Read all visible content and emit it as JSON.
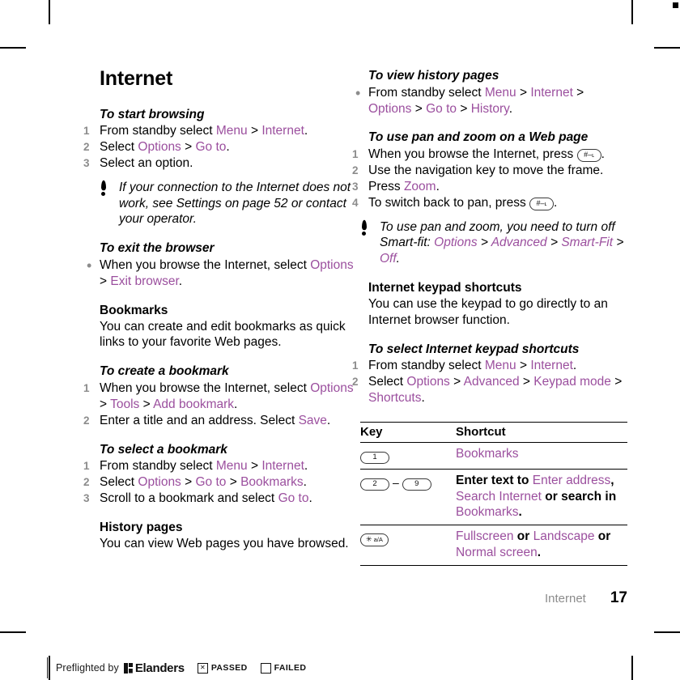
{
  "document": {
    "chapter_title": "Internet",
    "footer_chapter": "Internet",
    "page_number": "17",
    "link_color": "#9b4f9e"
  },
  "left_column": {
    "s1": {
      "heading": "To start browsing",
      "steps": [
        {
          "num": "1",
          "parts": [
            {
              "t": "From standby select ",
              "ui": false
            },
            {
              "t": "Menu",
              "ui": true
            },
            {
              "t": " > ",
              "ui": false
            },
            {
              "t": "Internet",
              "ui": true
            },
            {
              "t": ".",
              "ui": false
            }
          ]
        },
        {
          "num": "2",
          "parts": [
            {
              "t": "Select ",
              "ui": false
            },
            {
              "t": "Options",
              "ui": true
            },
            {
              "t": " > ",
              "ui": false
            },
            {
              "t": "Go to",
              "ui": true
            },
            {
              "t": ".",
              "ui": false
            }
          ]
        },
        {
          "num": "3",
          "parts": [
            {
              "t": "Select an option.",
              "ui": false
            }
          ]
        }
      ]
    },
    "note1": "If your connection to the Internet does not work, see Settings on page 52 or contact your operator.",
    "s2": {
      "heading": "To exit the browser",
      "bullets": [
        {
          "parts": [
            {
              "t": "When you browse the Internet, select ",
              "ui": false
            },
            {
              "t": "Options",
              "ui": true
            },
            {
              "t": " > ",
              "ui": false
            },
            {
              "t": "Exit browser",
              "ui": true
            },
            {
              "t": ".",
              "ui": false
            }
          ]
        }
      ]
    },
    "s3": {
      "heading": "Bookmarks",
      "body": "You can create and edit bookmarks as quick links to your favorite Web pages."
    },
    "s4": {
      "heading": "To create a bookmark",
      "steps": [
        {
          "num": "1",
          "parts": [
            {
              "t": "When you browse the Internet, select ",
              "ui": false
            },
            {
              "t": "Options",
              "ui": true
            },
            {
              "t": " > ",
              "ui": false
            },
            {
              "t": "Tools",
              "ui": true
            },
            {
              "t": " > ",
              "ui": false
            },
            {
              "t": "Add bookmark",
              "ui": true
            },
            {
              "t": ".",
              "ui": false
            }
          ]
        },
        {
          "num": "2",
          "parts": [
            {
              "t": "Enter a title and an address. Select ",
              "ui": false
            },
            {
              "t": "Save",
              "ui": true
            },
            {
              "t": ".",
              "ui": false
            }
          ]
        }
      ]
    },
    "s5": {
      "heading": "To select a bookmark",
      "steps": [
        {
          "num": "1",
          "parts": [
            {
              "t": "From standby select ",
              "ui": false
            },
            {
              "t": "Menu",
              "ui": true
            },
            {
              "t": " > ",
              "ui": false
            },
            {
              "t": "Internet",
              "ui": true
            },
            {
              "t": ".",
              "ui": false
            }
          ]
        },
        {
          "num": "2",
          "parts": [
            {
              "t": "Select ",
              "ui": false
            },
            {
              "t": "Options",
              "ui": true
            },
            {
              "t": " > ",
              "ui": false
            },
            {
              "t": "Go to",
              "ui": true
            },
            {
              "t": " > ",
              "ui": false
            },
            {
              "t": "Bookmarks",
              "ui": true
            },
            {
              "t": ".",
              "ui": false
            }
          ]
        },
        {
          "num": "3",
          "parts": [
            {
              "t": "Scroll to a bookmark and select ",
              "ui": false
            },
            {
              "t": "Go to",
              "ui": true
            },
            {
              "t": ".",
              "ui": false
            }
          ]
        }
      ]
    },
    "s6": {
      "heading": "History pages",
      "body": "You can view Web pages you have browsed."
    }
  },
  "right_column": {
    "s1": {
      "heading": "To view history pages",
      "bullets": [
        {
          "parts": [
            {
              "t": "From standby select ",
              "ui": false
            },
            {
              "t": "Menu",
              "ui": true
            },
            {
              "t": " > ",
              "ui": false
            },
            {
              "t": "Internet",
              "ui": true
            },
            {
              "t": " > ",
              "ui": false
            },
            {
              "t": "Options",
              "ui": true
            },
            {
              "t": " > ",
              "ui": false
            },
            {
              "t": "Go to",
              "ui": true
            },
            {
              "t": " > ",
              "ui": false
            },
            {
              "t": "History",
              "ui": true
            },
            {
              "t": ".",
              "ui": false
            }
          ]
        }
      ]
    },
    "s2": {
      "heading": "To use pan and zoom on a Web page",
      "steps": [
        {
          "num": "1",
          "pre": "When you browse the Internet, press ",
          "key": "hash",
          "post": "."
        },
        {
          "num": "2",
          "pre": "Use the navigation key to move the frame.",
          "key": null,
          "post": ""
        },
        {
          "num": "3",
          "parts": [
            {
              "t": "Press ",
              "ui": false
            },
            {
              "t": "Zoom",
              "ui": true
            },
            {
              "t": ".",
              "ui": false
            }
          ]
        },
        {
          "num": "4",
          "pre": "To switch back to pan, press ",
          "key": "hash",
          "post": "."
        }
      ]
    },
    "note1": {
      "parts": [
        {
          "t": "To use pan and zoom, you need to turn off Smart-fit: ",
          "ui": false
        },
        {
          "t": "Options",
          "ui": true
        },
        {
          "t": " > ",
          "ui": false
        },
        {
          "t": "Advanced",
          "ui": true
        },
        {
          "t": " > ",
          "ui": false
        },
        {
          "t": "Smart-Fit",
          "ui": true
        },
        {
          "t": " > ",
          "ui": false
        },
        {
          "t": "Off",
          "ui": true
        },
        {
          "t": ".",
          "ui": false
        }
      ]
    },
    "s3": {
      "heading": "Internet keypad shortcuts",
      "body": "You can use the keypad to go directly to an Internet browser function."
    },
    "s4": {
      "heading": "To select Internet keypad shortcuts",
      "steps": [
        {
          "num": "1",
          "parts": [
            {
              "t": "From standby select ",
              "ui": false
            },
            {
              "t": "Menu",
              "ui": true
            },
            {
              "t": " > ",
              "ui": false
            },
            {
              "t": "Internet",
              "ui": true
            },
            {
              "t": ".",
              "ui": false
            }
          ]
        },
        {
          "num": "2",
          "parts": [
            {
              "t": "Select ",
              "ui": false
            },
            {
              "t": "Options",
              "ui": true
            },
            {
              "t": " > ",
              "ui": false
            },
            {
              "t": "Advanced",
              "ui": true
            },
            {
              "t": " > ",
              "ui": false
            },
            {
              "t": "Keypad mode",
              "ui": true
            },
            {
              "t": " > ",
              "ui": false
            },
            {
              "t": "Shortcuts",
              "ui": true
            },
            {
              "t": ".",
              "ui": false
            }
          ]
        }
      ]
    },
    "table": {
      "headers": [
        "Key",
        "Shortcut"
      ],
      "rows": [
        {
          "keys": [
            {
              "label": "1",
              "type": "num"
            }
          ],
          "shortcut_parts": [
            {
              "t": "Bookmarks",
              "ui": true
            }
          ]
        },
        {
          "keys": [
            {
              "label": "2",
              "type": "num"
            },
            {
              "label": "–",
              "type": "dash"
            },
            {
              "label": "9",
              "type": "num"
            }
          ],
          "shortcut_parts": [
            {
              "t": "Enter text to ",
              "ui": false,
              "bold": true
            },
            {
              "t": "Enter address",
              "ui": true
            },
            {
              "t": ", ",
              "ui": false,
              "bold": true
            },
            {
              "t": "Search Internet",
              "ui": true
            },
            {
              "t": " or search in ",
              "ui": false,
              "bold": true
            },
            {
              "t": "Bookmarks",
              "ui": true
            },
            {
              "t": ".",
              "ui": false,
              "bold": true
            }
          ]
        },
        {
          "keys": [
            {
              "label": "✳ a/A",
              "type": "star"
            }
          ],
          "shortcut_parts": [
            {
              "t": "Fullscreen",
              "ui": true
            },
            {
              "t": " or ",
              "ui": false,
              "bold": true
            },
            {
              "t": "Landscape",
              "ui": true
            },
            {
              "t": " or ",
              "ui": false,
              "bold": true
            },
            {
              "t": "Normal screen",
              "ui": true
            },
            {
              "t": ".",
              "ui": false,
              "bold": true
            }
          ]
        }
      ]
    }
  },
  "preflight": {
    "text": "Preflighted by",
    "brand": "Elanders",
    "passed_label": "PASSED",
    "failed_label": "FAILED"
  }
}
